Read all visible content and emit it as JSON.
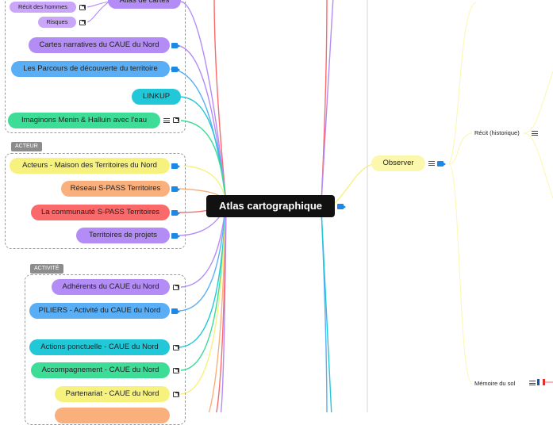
{
  "central": {
    "title": "Atlas cartographique"
  },
  "groups": {
    "acteur": {
      "label": "ACTEUR"
    },
    "activite": {
      "label": "ACTIVITÉ"
    }
  },
  "nodes": {
    "atlas_cartes": "Atlas de cartes",
    "recit_hommes": "Récit des hommes",
    "risques": "Risques",
    "cartes_narratives": "Cartes narratives du CAUE du Nord",
    "parcours": "Les Parcours de découverte du territoire",
    "linkup": "LINKUP",
    "imaginons": "Imaginons Menin & Halluin avec l'eau",
    "acteurs_maison": "Acteurs - Maison des Territoires du Nord",
    "reseau_spass": "Réseau S-PASS Territoires",
    "communaute_spass": "La communauté S-PASS Territoires",
    "territoires_projets": "Territoires de projets",
    "adherents": "Adhérents du CAUE du Nord",
    "piliers": "PILIERS - Activité du CAUE du Nord",
    "actions_ponctuelle": "Actions ponctuelle - CAUE du Nord",
    "accompagnement": "Accompagnement - CAUE du Nord",
    "partenariat": "Partenariat - CAUE du Nord",
    "observer": "Observer",
    "recit_historique": "Récit (historique)",
    "memoire_sol": "Mémoire du sol"
  },
  "colors": {
    "purple": "#b48cf5",
    "blue": "#5aaef5",
    "cyan": "#22c8d8",
    "green": "#3ddc97",
    "yellow": "#f7f27e",
    "orange": "#f9b07d",
    "red": "#fb6a6a",
    "pale_yellow": "#fbf7ad"
  },
  "icons": [
    "link-icon",
    "external-link-icon",
    "note-icon",
    "flag-icon"
  ]
}
